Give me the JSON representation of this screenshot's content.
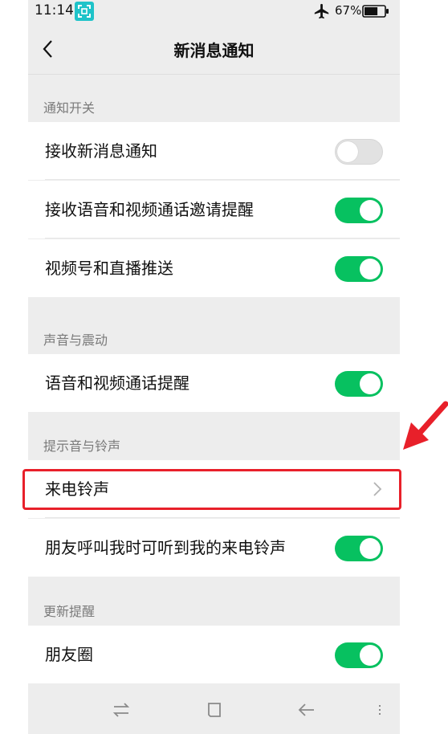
{
  "status_bar": {
    "time": "11:14",
    "battery_percent": "67%",
    "battery_level": 0.67,
    "icons": [
      "screen-capture-icon",
      "airplane-mode-icon",
      "battery-icon"
    ]
  },
  "nav": {
    "title": "新消息通知",
    "back_icon": "chevron-left-icon"
  },
  "sections": {
    "notification_switch": {
      "header": "通知开关",
      "items": [
        {
          "label": "接收新消息通知",
          "enabled": false
        },
        {
          "label": "接收语音和视频通话邀请提醒",
          "enabled": true
        },
        {
          "label": "视频号和直播推送",
          "enabled": true
        }
      ]
    },
    "sound_vibration": {
      "header": "声音与震动",
      "items": [
        {
          "label": "语音和视频通话提醒",
          "enabled": true
        }
      ]
    },
    "ringtone": {
      "header": "提示音与铃声",
      "items": [
        {
          "label": "来电铃声",
          "type": "link"
        },
        {
          "label": "朋友呼叫我时可听到我的来电铃声",
          "enabled": true
        }
      ]
    },
    "update_reminder": {
      "header": "更新提醒",
      "items": [
        {
          "label": "朋友圈",
          "enabled": true
        }
      ]
    }
  },
  "bottom_nav": {
    "icons": [
      "swap-icon",
      "home-square-icon",
      "back-arrow-icon",
      "menu-icon"
    ]
  },
  "colors": {
    "toggle_on": "#07c160",
    "toggle_off": "#e2e2e2",
    "page_background": "#ededed",
    "annotation_red": "#e8202a"
  }
}
